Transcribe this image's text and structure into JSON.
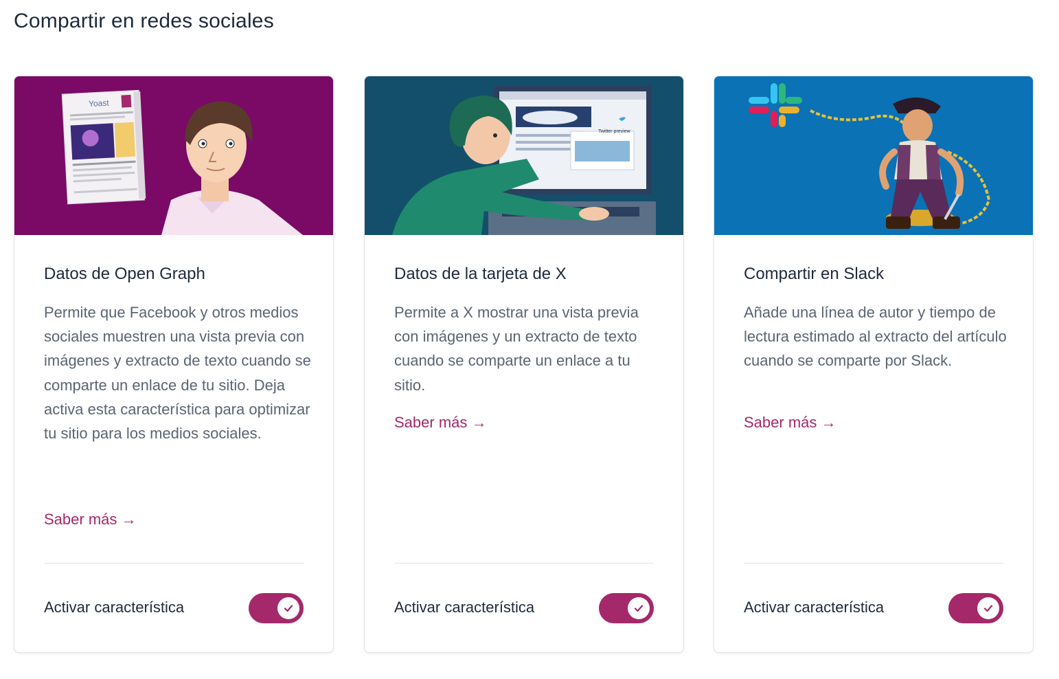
{
  "section": {
    "title": "Compartir en redes sociales"
  },
  "colors": {
    "accent": "#a4286a",
    "card1_bg": "#7a0a66",
    "card2_bg": "#134f6b",
    "card3_bg": "#0a72b5"
  },
  "cards": [
    {
      "title": "Datos de Open Graph",
      "description": "Permite que Facebook y otros medios sociales muestren una vista previa con imágenes y extracto de texto cuando se comparte un enlace de tu sitio. Deja activa esta característica para optimizar tu sitio para los medios sociales.",
      "learn_more": "Saber más →",
      "toggle_label": "Activar característica",
      "toggle_on": true,
      "illustration_label": "Yoast"
    },
    {
      "title": "Datos de la tarjeta de X",
      "description": "Permite a X mostrar una vista previa con imágenes y un extracto de texto cuando se comparte un enlace a tu sitio.",
      "learn_more": "Saber más →",
      "toggle_label": "Activar característica",
      "toggle_on": true,
      "illustration_label": "Twitter preview"
    },
    {
      "title": "Compartir en Slack",
      "description": "Añade una línea de autor y tiempo de lectura estimado al extracto del artículo cuando se comparte por Slack.",
      "learn_more": "Saber más →",
      "toggle_label": "Activar característica",
      "toggle_on": true
    }
  ]
}
